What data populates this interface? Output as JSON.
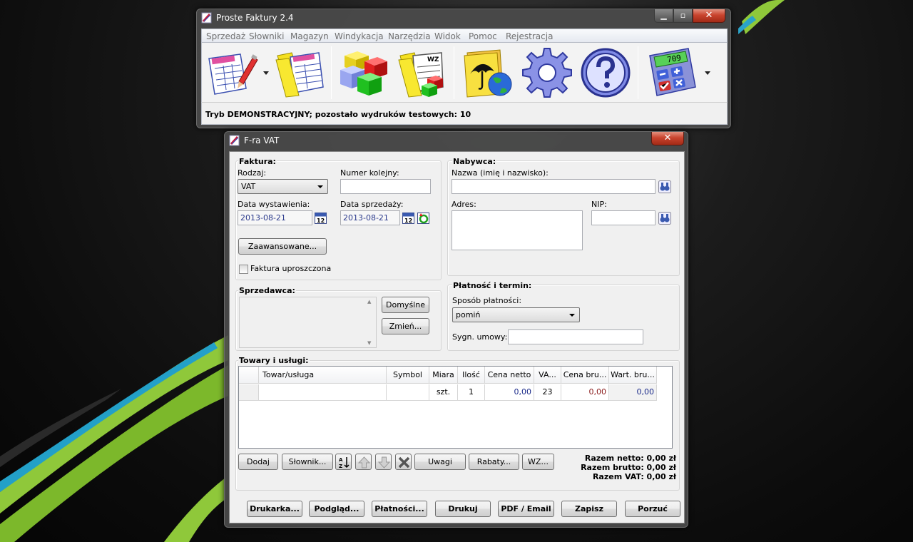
{
  "main_window": {
    "title": "Proste Faktury 2.4",
    "menu": [
      "Sprzedaż",
      "Słowniki",
      "Magazyn",
      "Windykacja",
      "Narzędzia",
      "Widok",
      "Pomoc",
      "Rejestracja"
    ],
    "toolbar": {
      "calc_display": "709",
      "buttons": [
        "new-invoice",
        "invoices-list",
        "warehouse",
        "warehouse-documents",
        "debt-collection",
        "settings",
        "help",
        "calculator"
      ]
    },
    "status": "Tryb DEMONSTRACYJNY; pozostało wydruków testowych: 10"
  },
  "dialog": {
    "title": "F-ra VAT",
    "faktura": {
      "group_label": "Faktura:",
      "rodzaj_label": "Rodzaj:",
      "rodzaj_value": "VAT",
      "numer_label": "Numer kolejny:",
      "numer_value": "",
      "data_wyst_label": "Data wystawienia:",
      "data_wyst_value": "2013-08-21",
      "data_sprz_label": "Data sprzedaży:",
      "data_sprz_value": "2013-08-21",
      "calendar_day": "12",
      "advanced_button": "Zaawansowane...",
      "uproszczona_label": "Faktura uproszczona"
    },
    "nabywca": {
      "group_label": "Nabywca:",
      "nazwa_label": "Nazwa (imię i nazwisko):",
      "nazwa_value": "",
      "adres_label": "Adres:",
      "nip_label": "NIP:",
      "nip_value": ""
    },
    "platnosc": {
      "group_label": "Płatność i termin:",
      "sposob_label": "Sposób płatności:",
      "sposob_value": "pomiń",
      "sygn_label": "Sygn. umowy:",
      "sygn_value": ""
    },
    "sprzedawca": {
      "group_label": "Sprzedawca:",
      "domyslne_button": "Domyślne",
      "zmien_button": "Zmień..."
    },
    "towary": {
      "group_label": "Towary i usługi:",
      "columns": [
        "Towar/usługa",
        "Symbol",
        "Miara",
        "Ilość",
        "Cena netto",
        "VA...",
        "Cena bru...",
        "Wart. bru..."
      ],
      "row": {
        "towar": "",
        "symbol": "",
        "miara": "szt.",
        "ilosc": "1",
        "cena_netto": "0,00",
        "vat": "23",
        "cena_brutto": "0,00",
        "wart_brutto": "0,00"
      },
      "buttons": {
        "dodaj": "Dodaj",
        "slownik": "Słownik...",
        "uwagi": "Uwagi",
        "rabaty": "Rabaty...",
        "wz": "WZ..."
      },
      "totals": {
        "netto": "Razem netto: 0,00 zł",
        "brutto": "Razem brutto: 0,00 zł",
        "vat": "Razem VAT: 0,00 zł"
      }
    },
    "bottom_buttons": {
      "drukarka": "Drukarka...",
      "podglad": "Podgląd...",
      "platnosci": "Płatności...",
      "drukuj": "Drukuj",
      "pdf": "PDF / Email",
      "zapisz": "Zapisz",
      "porzuc": "Porzuć"
    }
  }
}
